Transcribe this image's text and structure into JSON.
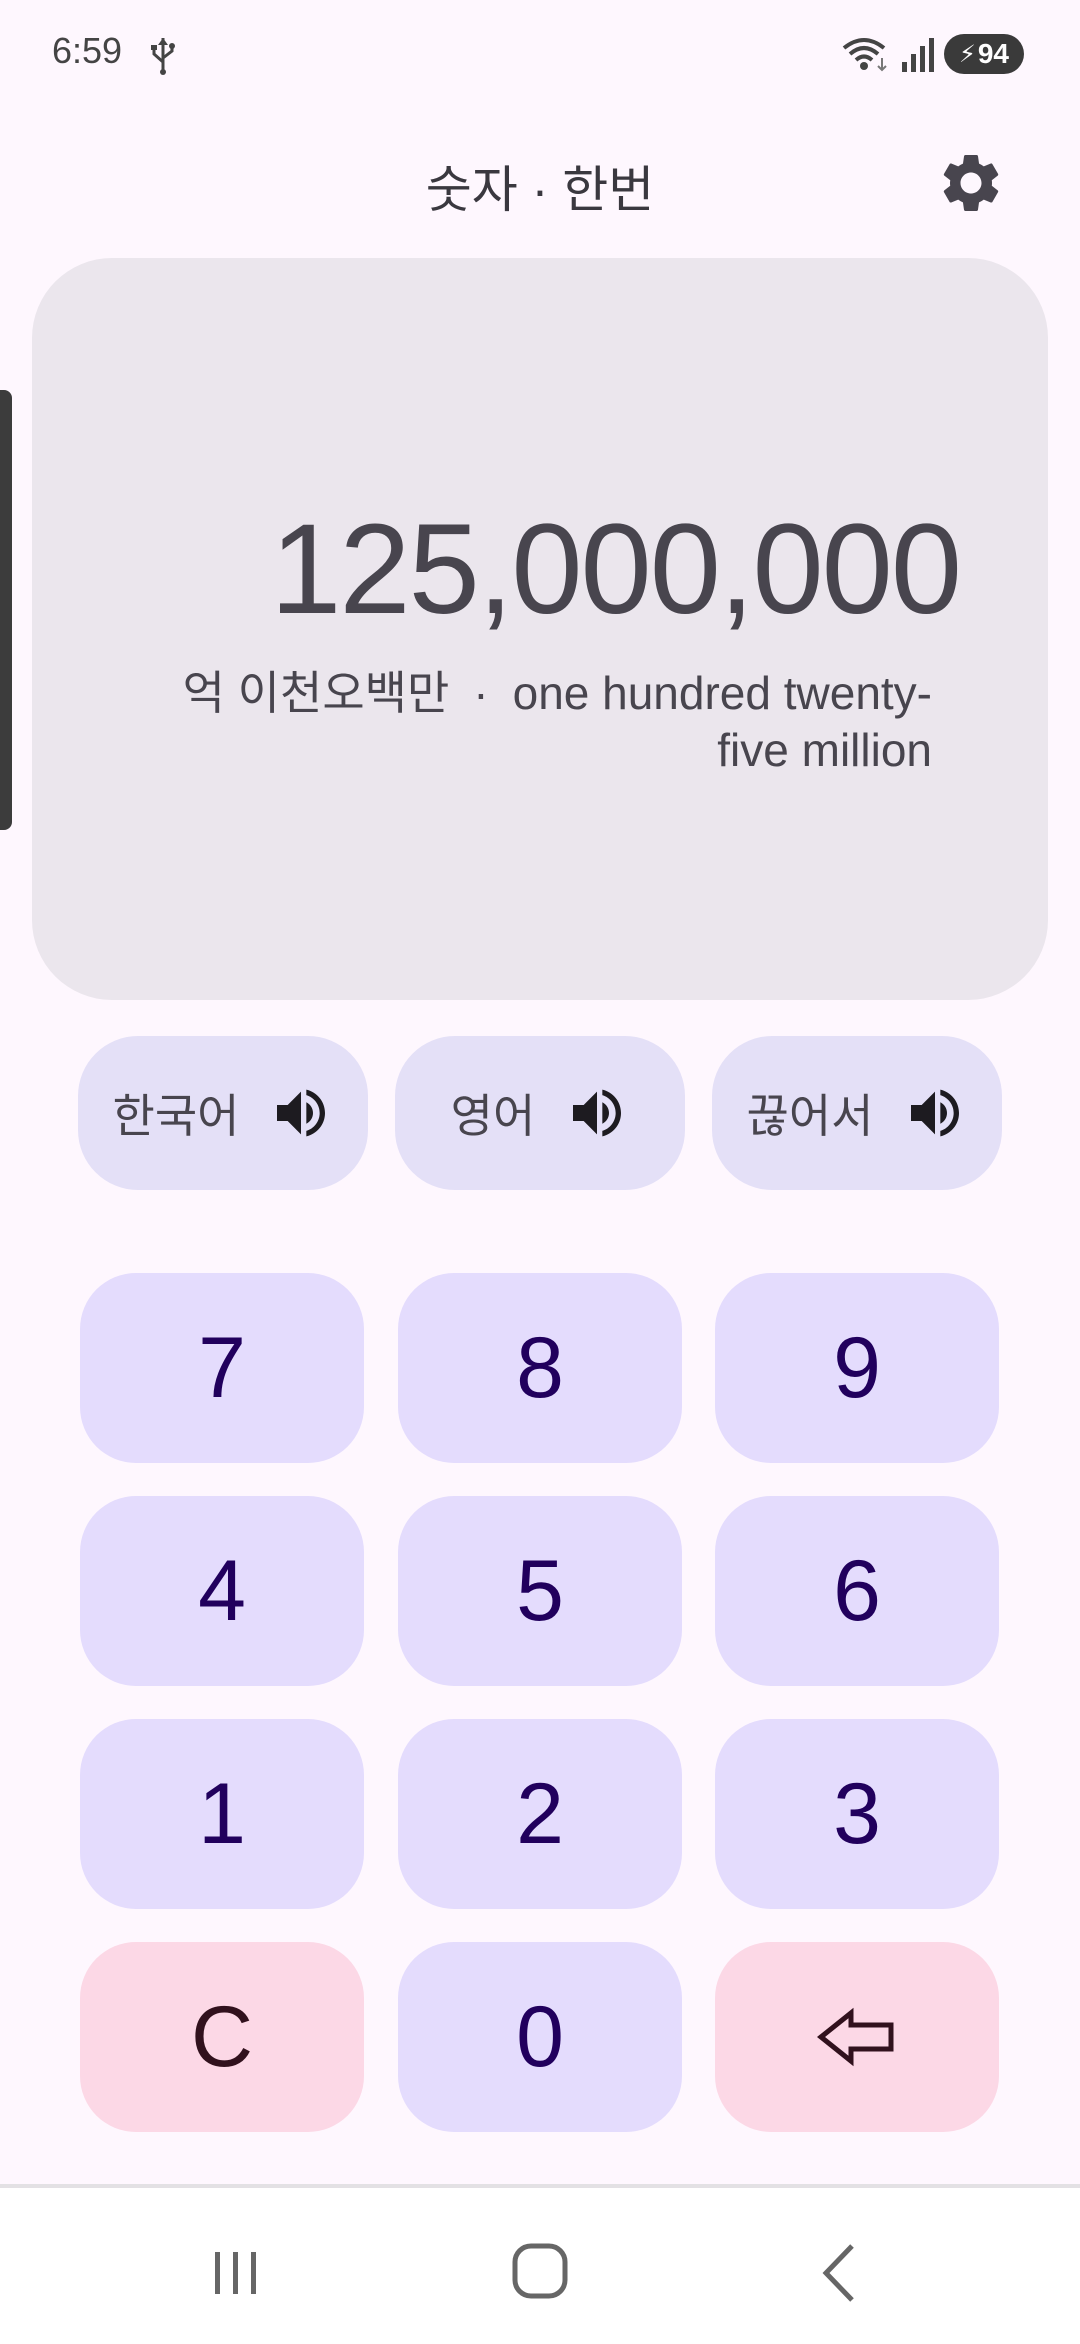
{
  "status_bar": {
    "time": "6:59",
    "battery_level": "94",
    "icons": [
      "usb-icon",
      "wifi-icon",
      "signal-icon",
      "battery-charging-icon"
    ]
  },
  "header": {
    "title": "숫자 · 한번",
    "settings_icon": "gear-icon"
  },
  "display": {
    "number": "125,000,000",
    "korean_words": "억 이천오백만",
    "separator": "·",
    "english_words": "one hundred twenty-five million"
  },
  "speak_buttons": [
    {
      "label": "한국어",
      "icon": "speaker-icon"
    },
    {
      "label": "영어",
      "icon": "speaker-icon"
    },
    {
      "label": "끊어서",
      "icon": "speaker-icon"
    }
  ],
  "keypad": {
    "rows": [
      [
        "7",
        "8",
        "9"
      ],
      [
        "4",
        "5",
        "6"
      ],
      [
        "1",
        "2",
        "3"
      ]
    ],
    "clear_label": "C",
    "zero_label": "0",
    "backspace_icon": "backspace-arrow-icon"
  },
  "colors": {
    "background": "#fef7fe",
    "display_card": "#ebe6ed",
    "digit_key": "#e4dcfd",
    "digit_text": "#21005d",
    "action_key": "#fcd8e6",
    "speak_button": "#e4e0f7"
  },
  "nav_bar": {
    "icons": [
      "recent-apps-icon",
      "home-icon",
      "back-icon"
    ]
  }
}
